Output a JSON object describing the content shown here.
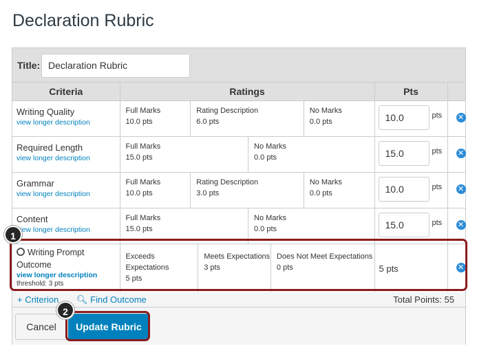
{
  "page": {
    "title": "Declaration Rubric"
  },
  "title_row": {
    "label": "Title:",
    "value": "Declaration Rubric"
  },
  "headers": {
    "criteria": "Criteria",
    "ratings": "Ratings",
    "pts": "Pts"
  },
  "criteria": [
    {
      "name": "Writing Quality",
      "link": "view longer description",
      "points": "10.0",
      "unit": "pts",
      "ratings": [
        {
          "title": "Full Marks",
          "points": "10.0 pts"
        },
        {
          "title": "Rating Description",
          "points": "6.0 pts"
        },
        {
          "title": "No Marks",
          "points": "0.0 pts"
        }
      ]
    },
    {
      "name": "Required Length",
      "link": "view longer description",
      "points": "15.0",
      "unit": "pts",
      "ratings": [
        {
          "title": "Full Marks",
          "points": "15.0 pts"
        },
        {
          "title": "No Marks",
          "points": "0.0 pts"
        }
      ]
    },
    {
      "name": "Grammar",
      "link": "view longer description",
      "points": "10.0",
      "unit": "pts",
      "ratings": [
        {
          "title": "Full Marks",
          "points": "10.0 pts"
        },
        {
          "title": "Rating Description",
          "points": "3.0 pts"
        },
        {
          "title": "No Marks",
          "points": "0.0 pts"
        }
      ]
    },
    {
      "name": "Content",
      "link": "view longer description",
      "points": "15.0",
      "unit": "pts",
      "ratings": [
        {
          "title": "Full Marks",
          "points": "15.0 pts"
        },
        {
          "title": "No Marks",
          "points": "0.0 pts"
        }
      ]
    }
  ],
  "outcome": {
    "name": "Writing Prompt Outcome",
    "link": "view longer description",
    "threshold": "threshold: 3 pts",
    "points": "5 pts",
    "ratings": [
      {
        "title": "Exceeds Expectations",
        "points": "5 pts"
      },
      {
        "title": "Meets Expectations",
        "points": "3 pts"
      },
      {
        "title": "Does Not Meet Expectations",
        "points": "0 pts"
      }
    ]
  },
  "footer": {
    "add_criterion": "+ Criterion",
    "find_outcome": "Find Outcome",
    "total_points": "Total Points: 55"
  },
  "buttons": {
    "cancel": "Cancel",
    "update": "Update Rubric"
  },
  "callouts": {
    "one": "1",
    "two": "2"
  },
  "icons": {
    "remove": "remove-icon",
    "search": "search-icon",
    "outcome": "outcome-icon"
  },
  "colors": {
    "link": "#0081bd",
    "primary": "#0081bd",
    "highlight": "#8a1c1c",
    "remove": "#2d8cd8"
  }
}
